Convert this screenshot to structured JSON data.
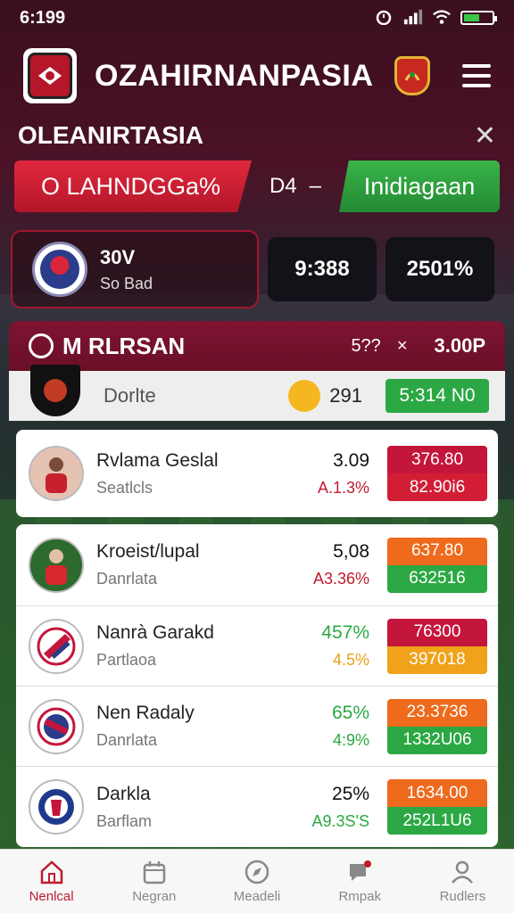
{
  "status": {
    "time": "6:199"
  },
  "header": {
    "title": "OZAHIRNANPASIA"
  },
  "sub": {
    "title": "OLEANIRTASIA"
  },
  "banner": {
    "left": "O LAHNDGGa%",
    "mid": "D4",
    "dash": "–",
    "right": "Inidiagaan"
  },
  "stats": {
    "team_big": "30V",
    "team_small": "So Bad",
    "box1": "9:388",
    "box2": "2501%"
  },
  "league": {
    "title": "M RLRSAN",
    "count": "5??",
    "close": "×",
    "total": "3.00P"
  },
  "featured": {
    "name": "Dorlte",
    "value": "291",
    "button": "5:314 N0"
  },
  "players": [
    {
      "name": "Rvlama Geslal",
      "team": "Seatlcls",
      "n1": "3.09",
      "n2": "A.1.3%",
      "n2_color": "#c01b2f",
      "odds_top": "376.80",
      "odds_bot": "82.90i6",
      "c_top": "#c4163b",
      "c_bot": "#d21d35"
    },
    {
      "name": "Kroeist/lupal",
      "team": "Danrlata",
      "n1": "5,08",
      "n2": "A3.36%",
      "n2_color": "#c01b2f",
      "odds_top": "637.80",
      "odds_bot": "632516",
      "c_top": "#ee6a1d",
      "c_bot": "#2ba843"
    },
    {
      "name": "Nanrà Garakd",
      "team": "Partlaoa",
      "n1": "457%",
      "n2": "4.5%",
      "n1_color": "#2ba843",
      "n2_color": "#e6a017",
      "odds_top": "76300",
      "odds_bot": "397018",
      "c_top": "#c4163b",
      "c_bot": "#f0a21a"
    },
    {
      "name": "Nen Radaly",
      "team": "Danrlata",
      "n1": "65%",
      "n2": "4:9%",
      "n1_color": "#2ba843",
      "n2_color": "#2ba843",
      "odds_top": "23.3736",
      "odds_bot": "1332U06",
      "c_top": "#ee6a1d",
      "c_bot": "#2ba843"
    },
    {
      "name": "Darkla",
      "team": "Barflam",
      "n1": "25%",
      "n2": "A9.3S'S",
      "n2_color": "#2ba843",
      "odds_top": "1634.00",
      "odds_bot": "252L1U6",
      "c_top": "#ee6a1d",
      "c_bot": "#2ba843"
    }
  ],
  "nav": [
    {
      "label": "Nenlcal",
      "icon": "home-icon"
    },
    {
      "label": "Negran",
      "icon": "calendar-icon"
    },
    {
      "label": "Meadeli",
      "icon": "compass-icon"
    },
    {
      "label": "Rmpak",
      "icon": "chat-icon"
    },
    {
      "label": "Rudlers",
      "icon": "profile-icon"
    }
  ]
}
